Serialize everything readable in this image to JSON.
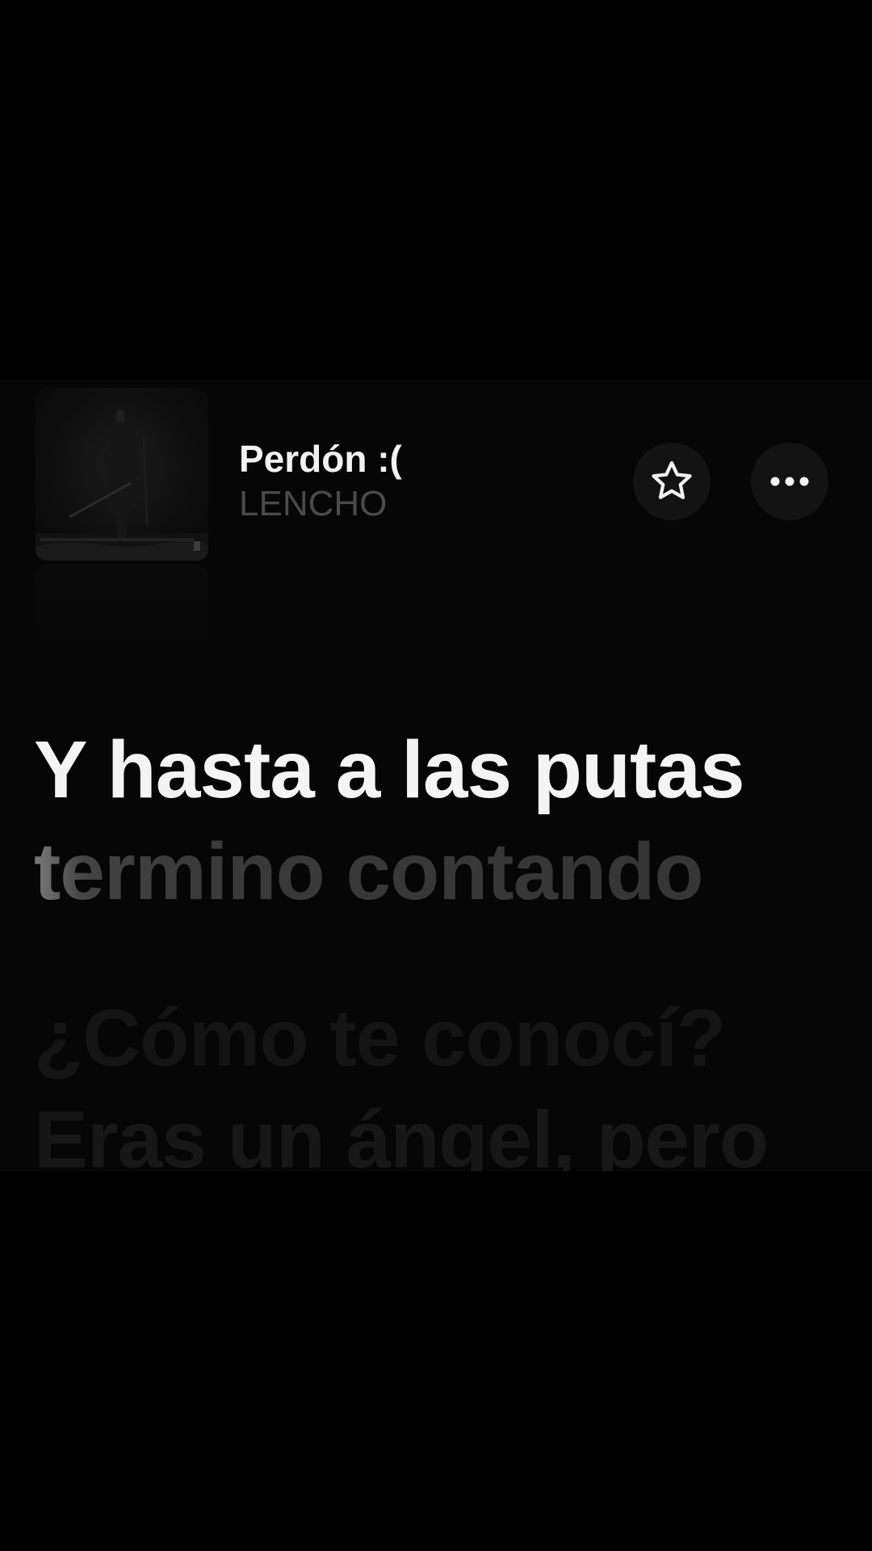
{
  "now_playing": {
    "title": "Perdón :(",
    "artist": "LENCHO",
    "artwork_icon": "album-artwork",
    "favorite_icon": "star-outline-icon",
    "more_icon": "ellipsis-icon"
  },
  "lyrics": {
    "active_line": "Y hasta a las putas",
    "next_line": "termino contando",
    "upcoming": [
      "¿Cómo te conocí?",
      "Eras un ángel, pero"
    ]
  },
  "colors": {
    "background": "#000000",
    "panel": "#060606",
    "active_text": "#f4f4f4",
    "secondary_text": "#4a4a4a",
    "button_bg": "#131313"
  }
}
